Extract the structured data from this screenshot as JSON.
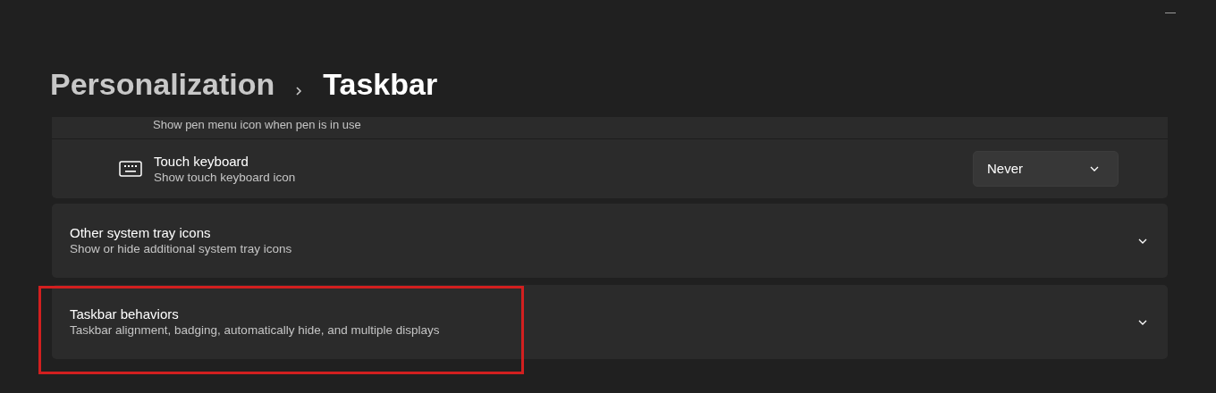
{
  "breadcrumb": [
    {
      "label": "Personalization",
      "current": false
    },
    {
      "label": "Taskbar",
      "current": true
    }
  ],
  "pen_row": {
    "description": "Show pen menu icon when pen is in use"
  },
  "touch_keyboard": {
    "title": "Touch keyboard",
    "description": "Show touch keyboard icon",
    "dropdown": {
      "value": "Never"
    }
  },
  "sections": [
    {
      "title": "Other system tray icons",
      "description": "Show or hide additional system tray icons",
      "expanded": false,
      "highlighted": false
    },
    {
      "title": "Taskbar behaviors",
      "description": "Taskbar alignment, badging, automatically hide, and multiple displays",
      "expanded": false,
      "highlighted": true
    }
  ]
}
